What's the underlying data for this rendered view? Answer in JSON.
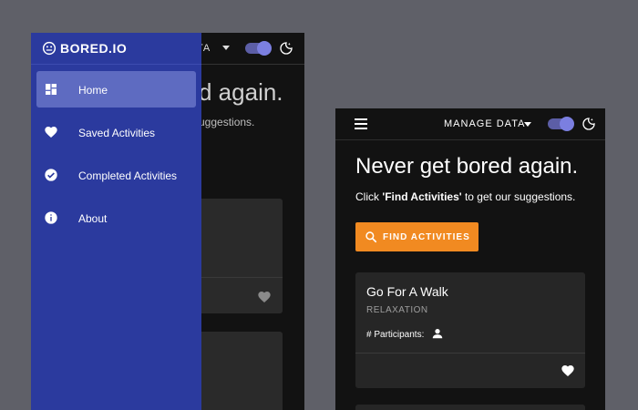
{
  "left_screen": {
    "toolbar": {
      "manage_partial": "TA"
    },
    "headline_partial": "d again.",
    "subtext_partial": "uggestions."
  },
  "drawer": {
    "brand": "BORED.IO",
    "items": [
      {
        "label": "Home",
        "icon": "dashboard-icon",
        "active": true
      },
      {
        "label": "Saved Activities",
        "icon": "heart-icon",
        "active": false
      },
      {
        "label": "Completed Activities",
        "icon": "check-circle-icon",
        "active": false
      },
      {
        "label": "About",
        "icon": "info-icon",
        "active": false
      }
    ]
  },
  "right_screen": {
    "toolbar": {
      "manage_label": "MANAGE DATA",
      "dark_mode": true
    },
    "headline": "Never get bored again.",
    "subtext_pre": "Click ",
    "subtext_bold": "'Find Activities'",
    "subtext_post": " to get our suggestions.",
    "find_button": "FIND ACTIVITIES",
    "activity": {
      "title": "Go For A Walk",
      "type": "RELAXATION",
      "participants_label": "# Participants:"
    }
  },
  "colors": {
    "background": "#5f6068",
    "drawer": "#2b3a9e",
    "drawer_active": "#5e6bc1",
    "accent": "#f18a21",
    "toggle": "#7b7fe0",
    "surface": "#121212",
    "card": "#262626"
  }
}
